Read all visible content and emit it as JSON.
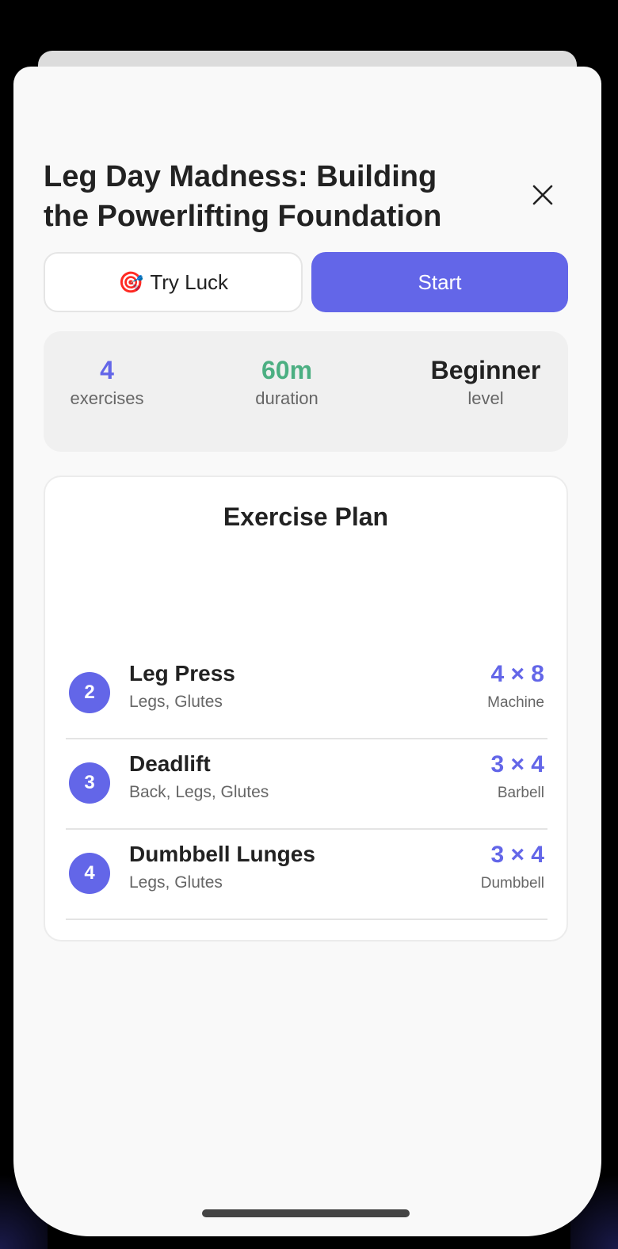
{
  "workout": {
    "title": "Leg Day Madness: Building the Powerlifting Foundation"
  },
  "actions": {
    "try_luck_label": "Try Luck",
    "try_luck_emoji": "🎯",
    "start_label": "Start"
  },
  "stats": [
    {
      "value": "4",
      "label": "exercises",
      "color": "#6366e8"
    },
    {
      "value": "60m",
      "label": "duration",
      "color": "#4caf82"
    },
    {
      "value": "Beginner",
      "label": "level",
      "color": "#222222"
    }
  ],
  "plan": {
    "title": "Exercise Plan",
    "exercises": [
      {
        "number": "2",
        "name": "Leg Press",
        "muscles": "Legs, Glutes",
        "sets": "4 × 8",
        "equipment": "Machine"
      },
      {
        "number": "3",
        "name": "Deadlift",
        "muscles": "Back, Legs, Glutes",
        "sets": "3 × 4",
        "equipment": "Barbell"
      },
      {
        "number": "4",
        "name": "Dumbbell Lunges",
        "muscles": "Legs, Glutes",
        "sets": "3 × 4",
        "equipment": "Dumbbell"
      }
    ]
  },
  "icons": {
    "close": "close-icon",
    "dart": "dart-target-icon"
  },
  "colors": {
    "accent": "#6366e8",
    "duration_green": "#4caf82"
  }
}
